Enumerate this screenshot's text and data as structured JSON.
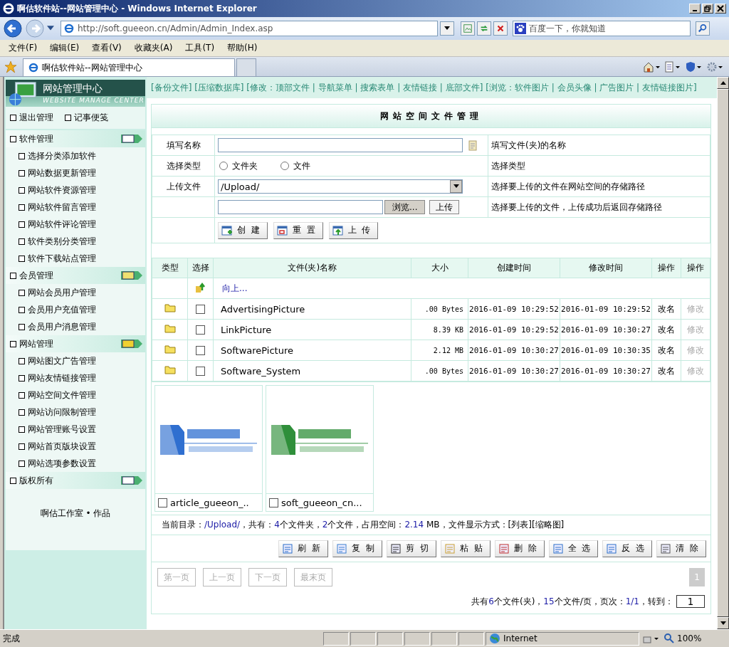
{
  "window": {
    "title": "啊估软件站--网站管理中心 - Windows Internet Explorer"
  },
  "address_bar": {
    "url": "http://soft.gueeon.cn/Admin/Admin_Index.asp",
    "search_placeholder": "百度一下，你就知道"
  },
  "menu": [
    "文件(F)",
    "编辑(E)",
    "查看(V)",
    "收藏夹(A)",
    "工具(T)",
    "帮助(H)"
  ],
  "tabs": [
    {
      "label": "啊估软件站--网站管理中心",
      "selected": true
    }
  ],
  "sidebar": {
    "title": "网站管理中心",
    "subtitle": "WEBSITE MANAGE CENTER",
    "top_links": [
      "退出管理",
      "记事便笺"
    ],
    "sections": [
      {
        "label": "软件管理",
        "children": [
          "选择分类添加软件",
          "网站数据更新管理",
          "网站软件资源管理",
          "网站软件留言管理",
          "网站软件评论管理",
          "软件类别分类管理",
          "软件下载站点管理"
        ]
      },
      {
        "label": "会员管理",
        "children": [
          "网站会员用户管理",
          "会员用户充值管理",
          "会员用户消息管理"
        ]
      },
      {
        "label": "网站管理",
        "children": [
          "网站图文广告管理",
          "网站友情链接管理",
          "网站空间文件管理",
          "网站访问限制管理",
          "网站管理账号设置",
          "网站首页版块设置",
          "网站选项参数设置"
        ]
      },
      {
        "label": "版权所有"
      }
    ],
    "footer": "啊估工作室 • 作品"
  },
  "link_bar": "[备份文件] [压缩数据库] [修改：顶部文件 | 导航菜单 | 搜索表单 | 友情链接 | 底部文件] [浏览：软件图片 | 会员头像 | 广告图片 | 友情链接图片]",
  "panel_title": "网站空间文件管理",
  "form": {
    "name_label": "填写名称",
    "name_hint": "填写文件(夹)的名称",
    "type_label": "选择类型",
    "type_options": [
      {
        "label": "文件夹",
        "selected": false
      },
      {
        "label": "文件",
        "selected": false
      }
    ],
    "type_hint": "选择类型",
    "upload_label": "上传文件",
    "path_value": "/Upload/",
    "path_hint": "选择要上传的文件在网站空间的存储路径",
    "browse_button": "浏览...",
    "upload_button": "上传",
    "file_hint": "选择要上传的文件，上传成功后返回存储路径",
    "buttons": [
      "创 建",
      "重 置",
      "上 传"
    ]
  },
  "table": {
    "columns": [
      "类型",
      "选择",
      "文件(夹)名称",
      "大小",
      "创建时间",
      "修改时间",
      "操作",
      "操作"
    ],
    "up_link": "向上...",
    "rows": [
      {
        "name": "AdvertisingPicture",
        "checked": false,
        "size": ".00 Bytes",
        "created": "2016-01-09 10:29:52",
        "modified": "2016-01-09 10:29:52",
        "rename": "改名",
        "edit": "修改",
        "edit_disabled": true
      },
      {
        "name": "LinkPicture",
        "checked": false,
        "size": "8.39 KB",
        "created": "2016-01-09 10:29:52",
        "modified": "2016-01-09 10:30:27",
        "rename": "改名",
        "edit": "修改",
        "edit_disabled": true
      },
      {
        "name": "SoftwarePicture",
        "checked": false,
        "size": "2.12 MB",
        "created": "2016-01-09 10:30:27",
        "modified": "2016-01-09 10:30:35",
        "rename": "改名",
        "edit": "修改",
        "edit_disabled": true
      },
      {
        "name": "Software_System",
        "checked": false,
        "size": ".00 Bytes",
        "created": "2016-01-09 10:30:27",
        "modified": "2016-01-09 10:30:27",
        "rename": "改名",
        "edit": "修改",
        "edit_disabled": true
      }
    ]
  },
  "thumbnails": [
    {
      "caption": "article_gueeon_..",
      "checked": false,
      "color": "#2f6fd0"
    },
    {
      "caption": "soft_gueeon_cn...",
      "checked": false,
      "color": "#2f8f3a"
    }
  ],
  "summary": [
    {
      "text": "当前目录：",
      "highlight": false
    },
    {
      "text": "/Upload/",
      "highlight": true
    },
    {
      "text": "，共有：",
      "highlight": false
    },
    {
      "text": "4",
      "highlight": true
    },
    {
      "text": "个文件夹，",
      "highlight": false
    },
    {
      "text": "2",
      "highlight": true
    },
    {
      "text": "个文件，占用空间：",
      "highlight": false
    },
    {
      "text": "2.14",
      "highlight": true
    },
    {
      "text": " MB，文件显示方式：[列表][缩略图]",
      "highlight": false
    }
  ],
  "actions": [
    "刷 新",
    "复 制",
    "剪 切",
    "粘 贴",
    "删 除",
    "全 选",
    "反 选",
    "清 除"
  ],
  "pager": {
    "buttons": [
      {
        "label": "第一页",
        "disabled": true
      },
      {
        "label": "上一页",
        "disabled": true
      },
      {
        "label": "下一页",
        "disabled": true
      },
      {
        "label": "最末页",
        "disabled": true
      }
    ],
    "current_page": "1",
    "info": [
      {
        "text": "共有",
        "highlight": false
      },
      {
        "text": "6",
        "highlight": true
      },
      {
        "text": "个文件(夹)，",
        "highlight": false
      },
      {
        "text": "15",
        "highlight": true
      },
      {
        "text": "个文件/页，页次：",
        "highlight": false
      },
      {
        "text": "1/1",
        "highlight": true
      },
      {
        "text": "，转到：",
        "highlight": false
      }
    ],
    "goto_value": "1"
  },
  "status_bar": {
    "text": "完成",
    "zone": "Internet",
    "zoom": "100%"
  }
}
